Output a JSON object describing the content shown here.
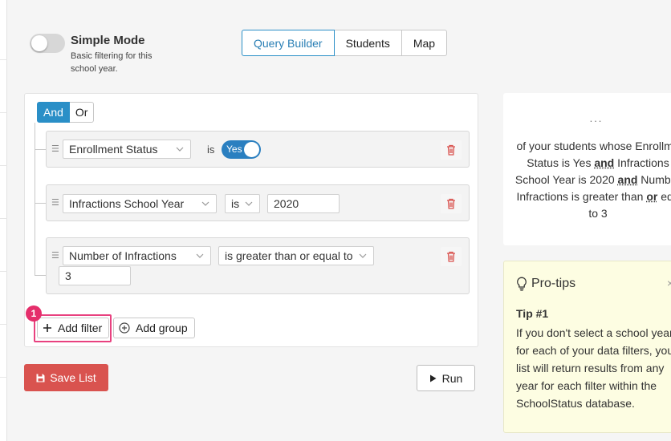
{
  "simple_mode": {
    "title": "Simple Mode",
    "description": "Basic filtering for this school year."
  },
  "view_tabs": [
    {
      "label": "Query Builder",
      "active": true
    },
    {
      "label": "Students",
      "active": false
    },
    {
      "label": "Map",
      "active": false
    }
  ],
  "query": {
    "and_label": "And",
    "or_label": "Or",
    "rules": [
      {
        "field": "Enrollment Status",
        "operator": "is",
        "toggle_label": "Yes"
      },
      {
        "field": "Infractions School Year",
        "operator": "is",
        "value": "2020"
      },
      {
        "field": "Number of Infractions",
        "operator": "is greater than or equal to",
        "value": "3"
      }
    ],
    "add_filter_label": "Add filter",
    "add_group_label": "Add group",
    "step_badge": "1"
  },
  "actions": {
    "save_label": "Save List",
    "run_label": "Run"
  },
  "summary": {
    "dots": "...",
    "lines": [
      [
        "of your students whose Enrollme"
      ],
      [
        "Status is Yes ",
        "and",
        " Infractions"
      ],
      [
        "School Year is 2020 ",
        "and",
        " Number"
      ],
      [
        "Infractions is greater than ",
        "or",
        " equ"
      ],
      [
        "to 3"
      ]
    ]
  },
  "protips": {
    "title": "Pro-tips",
    "close": "×",
    "tip_label": "Tip #1",
    "body_lines": [
      "If you don't select a school year",
      "for each of your data filters, you",
      "list will return results from any",
      "year for each filter within the",
      "SchoolStatus database."
    ]
  },
  "colors": {
    "primary": "#2a8fc7",
    "danger": "#d9534f",
    "highlight": "#e8417f",
    "protip_bg": "#fdfde2"
  }
}
